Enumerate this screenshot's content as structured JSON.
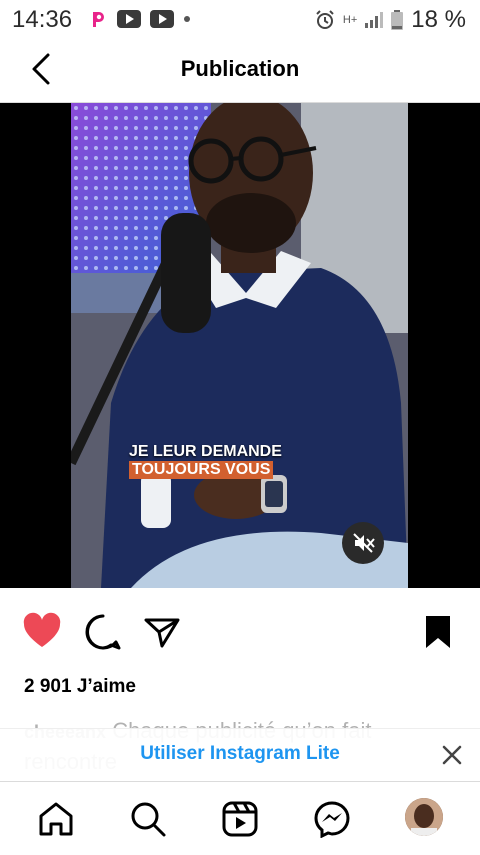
{
  "status_bar": {
    "time": "14:36",
    "battery": "18 %",
    "network": "H+"
  },
  "header": {
    "title": "Publication"
  },
  "video": {
    "subtitle_line1": "JE LEUR DEMANDE",
    "subtitle_line2": "TOUJOURS VOUS"
  },
  "post": {
    "likes": "2 901 J’aime",
    "caption_user": "cheeeanx",
    "caption_text": "Chaque publicité qu’on fait",
    "caption_line2": "rencontre"
  },
  "lite_banner": {
    "label": "Utiliser Instagram Lite"
  },
  "colors": {
    "like": "#ed4956",
    "link": "#1e95f0"
  }
}
